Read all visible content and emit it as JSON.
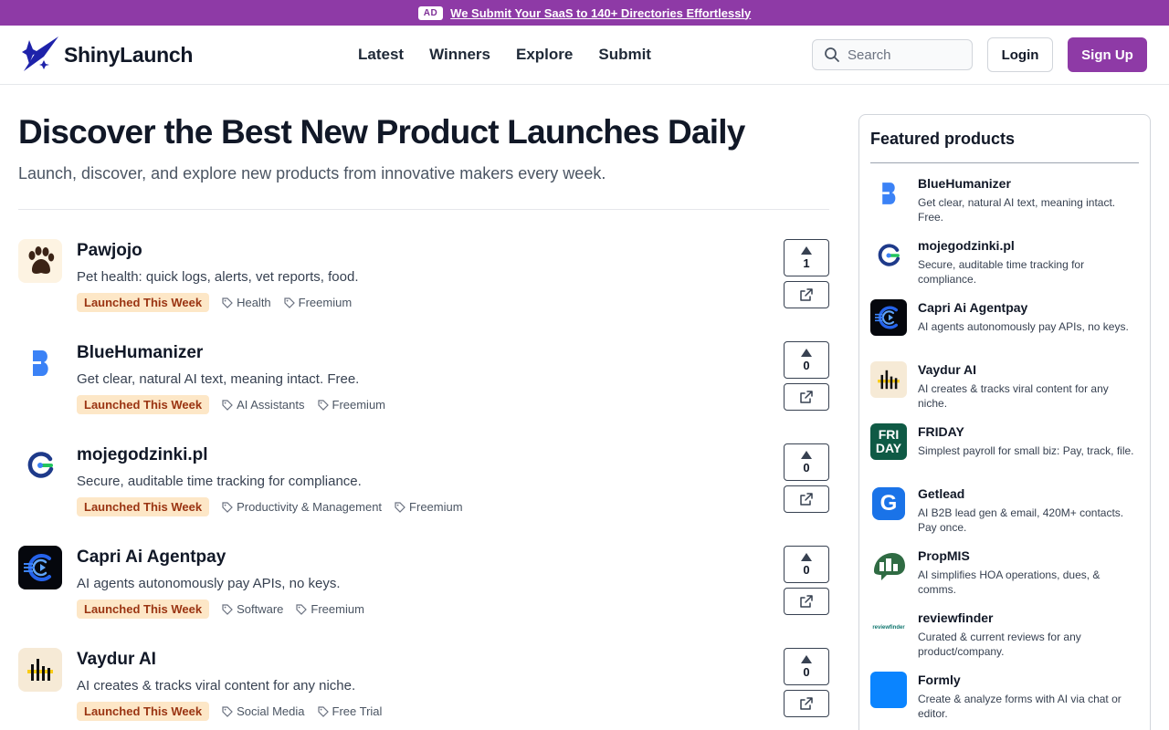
{
  "ad": {
    "badge": "AD",
    "text": "We Submit Your SaaS to 140+ Directories Effortlessly"
  },
  "header": {
    "brand": "ShinyLaunch",
    "nav": [
      "Latest",
      "Winners",
      "Explore",
      "Submit"
    ],
    "search_placeholder": "Search",
    "login_label": "Login",
    "signup_label": "Sign Up"
  },
  "hero": {
    "title": "Discover the Best New Product Launches Daily",
    "subtitle": "Launch, discover, and explore new products from innovative makers every week."
  },
  "products": [
    {
      "name": "Pawjojo",
      "desc": "Pet health: quick logs, alerts, vet reports, food.",
      "badge": "Launched This Week",
      "tags": [
        "Health",
        "Freemium"
      ],
      "votes": "1",
      "icon": "paw-icon"
    },
    {
      "name": "BlueHumanizer",
      "desc": "Get clear, natural AI text, meaning intact. Free.",
      "badge": "Launched This Week",
      "tags": [
        "AI Assistants",
        "Freemium"
      ],
      "votes": "0",
      "icon": "bluehumanizer-logo-icon"
    },
    {
      "name": "mojegodzinki.pl",
      "desc": "Secure, auditable time tracking for compliance.",
      "badge": "Launched This Week",
      "tags": [
        "Productivity & Management",
        "Freemium"
      ],
      "votes": "0",
      "icon": "mojegodzinki-logo-icon"
    },
    {
      "name": "Capri Ai Agentpay",
      "desc": "AI agents autonomously pay APIs, no keys.",
      "badge": "Launched This Week",
      "tags": [
        "Software",
        "Freemium"
      ],
      "votes": "0",
      "icon": "capri-logo-icon"
    },
    {
      "name": "Vaydur AI",
      "desc": "AI creates & tracks viral content for any niche.",
      "badge": "Launched This Week",
      "tags": [
        "Social Media",
        "Free Trial"
      ],
      "votes": "0",
      "icon": "vaydur-logo-icon"
    }
  ],
  "featured": {
    "title": "Featured products",
    "items": [
      {
        "name": "BlueHumanizer",
        "desc": "Get clear, natural AI text, meaning intact. Free.",
        "icon": "bluehumanizer-logo-icon"
      },
      {
        "name": "mojegodzinki.pl",
        "desc": "Secure, auditable time tracking for compliance.",
        "icon": "mojegodzinki-logo-icon"
      },
      {
        "name": "Capri Ai Agentpay",
        "desc": "AI agents autonomously pay APIs, no keys.",
        "icon": "capri-logo-icon"
      },
      {
        "name": "Vaydur AI",
        "desc": "AI creates & tracks viral content for any niche.",
        "icon": "vaydur-logo-icon"
      },
      {
        "name": "FRIDAY",
        "desc": "Simplest payroll for small biz: Pay, track, file.",
        "icon": "friday-logo-icon",
        "logo_text": [
          "FRI",
          "DAY"
        ]
      },
      {
        "name": "Getlead",
        "desc": "AI B2B lead gen & email, 420M+ contacts. Pay once.",
        "icon": "getlead-logo-icon",
        "logo_text": "G"
      },
      {
        "name": "PropMIS",
        "desc": "AI simplifies HOA operations, dues, & comms.",
        "icon": "propmis-logo-icon"
      },
      {
        "name": "reviewfinder",
        "desc": "Curated & current reviews for any product/company.",
        "icon": "reviewfinder-logo-icon",
        "logo_text": "reviewfinder"
      },
      {
        "name": "Formly",
        "desc": "Create & analyze forms with AI via chat or editor.",
        "icon": "formly-logo-icon"
      }
    ]
  },
  "colors": {
    "brand_purple": "#8e3aa6",
    "badge_bg": "#fde7c7",
    "badge_text": "#9a3412",
    "humanizer_blue": "#3b82f6",
    "friday_green": "#0f5a45",
    "getlead_blue": "#1a73e8",
    "formly_blue": "#0a84ff"
  }
}
